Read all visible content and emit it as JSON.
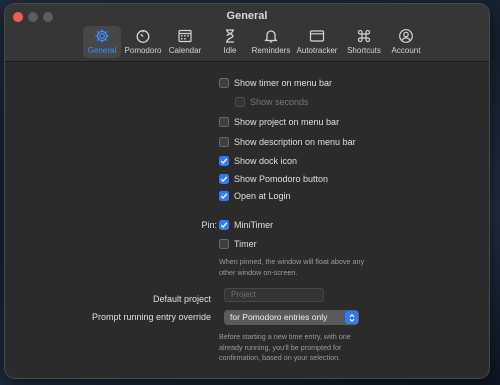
{
  "window": {
    "title": "General"
  },
  "tabs": [
    {
      "id": "general",
      "label": "General",
      "icon": "gear-icon",
      "active": true
    },
    {
      "id": "pomodoro",
      "label": "Pomodoro",
      "icon": "timer-icon"
    },
    {
      "id": "calendar",
      "label": "Calendar",
      "icon": "calendar-icon"
    },
    {
      "id": "idle",
      "label": "Idle",
      "icon": "hourglass-icon"
    },
    {
      "id": "reminders",
      "label": "Reminders",
      "icon": "bell-icon"
    },
    {
      "id": "autotracker",
      "label": "Autotracker",
      "icon": "window-icon"
    },
    {
      "id": "shortcuts",
      "label": "Shortcuts",
      "icon": "command-icon"
    },
    {
      "id": "account",
      "label": "Account",
      "icon": "user-circle-icon"
    }
  ],
  "options": [
    {
      "label": "Show timer on menu bar",
      "checked": false
    },
    {
      "label": "Show seconds",
      "checked": false,
      "disabled": true
    },
    {
      "label": "Show project on menu bar",
      "checked": false
    },
    {
      "label": "Show description on menu bar",
      "checked": false
    },
    {
      "label": "Show dock icon",
      "checked": true
    },
    {
      "label": "Show Pomodoro button",
      "checked": true
    },
    {
      "label": "Open at Login",
      "checked": true
    }
  ],
  "pin": {
    "label": "Pin:",
    "options": [
      {
        "label": "MiniTimer",
        "checked": true
      },
      {
        "label": "Timer",
        "checked": false
      }
    ],
    "help": [
      "When pinned, the window will float above any",
      "other window on-screen."
    ]
  },
  "default_project": {
    "label": "Default project",
    "placeholder": "Project",
    "value": ""
  },
  "prompt_override": {
    "label": "Prompt running entry override",
    "selected": "for Pomodoro entries only",
    "help": [
      "Before starting a new time entry, with one",
      "already running, you'll be prompted for",
      "confirmation, based on your selection."
    ]
  },
  "colors": {
    "accent": "#2f7cf6",
    "close": "#ec5f57",
    "window_bg": "#2b2b2b",
    "titlebar_bg": "#363636"
  }
}
